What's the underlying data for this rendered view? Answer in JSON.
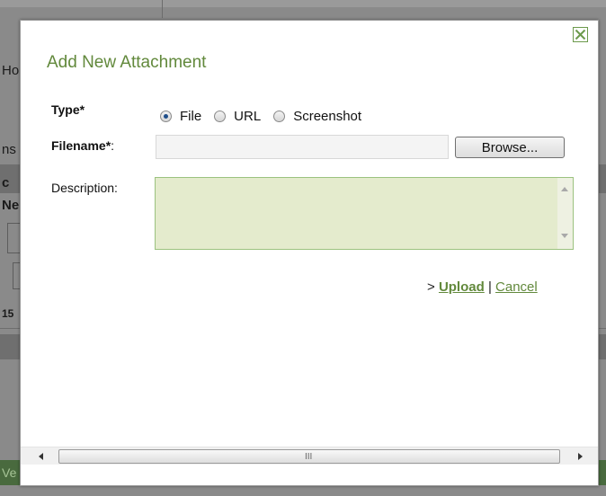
{
  "background": {
    "fragments": [
      "Ho",
      "ns",
      "c",
      "Ne",
      "15",
      "Ve"
    ]
  },
  "dialog": {
    "title": "Add New Attachment",
    "type_label": "Type*",
    "type_options": [
      {
        "label": "File",
        "selected": true
      },
      {
        "label": "URL",
        "selected": false
      },
      {
        "label": "Screenshot",
        "selected": false
      }
    ],
    "filename_label": "Filename*",
    "filename_colon": ":",
    "filename_value": "",
    "browse_label": "Browse...",
    "description_label": "Description:",
    "description_value": "",
    "action_prefix": "> ",
    "upload_label": "Upload",
    "separator": " | ",
    "cancel_label": "Cancel",
    "scroll_grip": "III"
  },
  "colors": {
    "accent_green": "#62893c",
    "description_bg": "#e4ebcd",
    "description_border": "#9bc27f"
  }
}
